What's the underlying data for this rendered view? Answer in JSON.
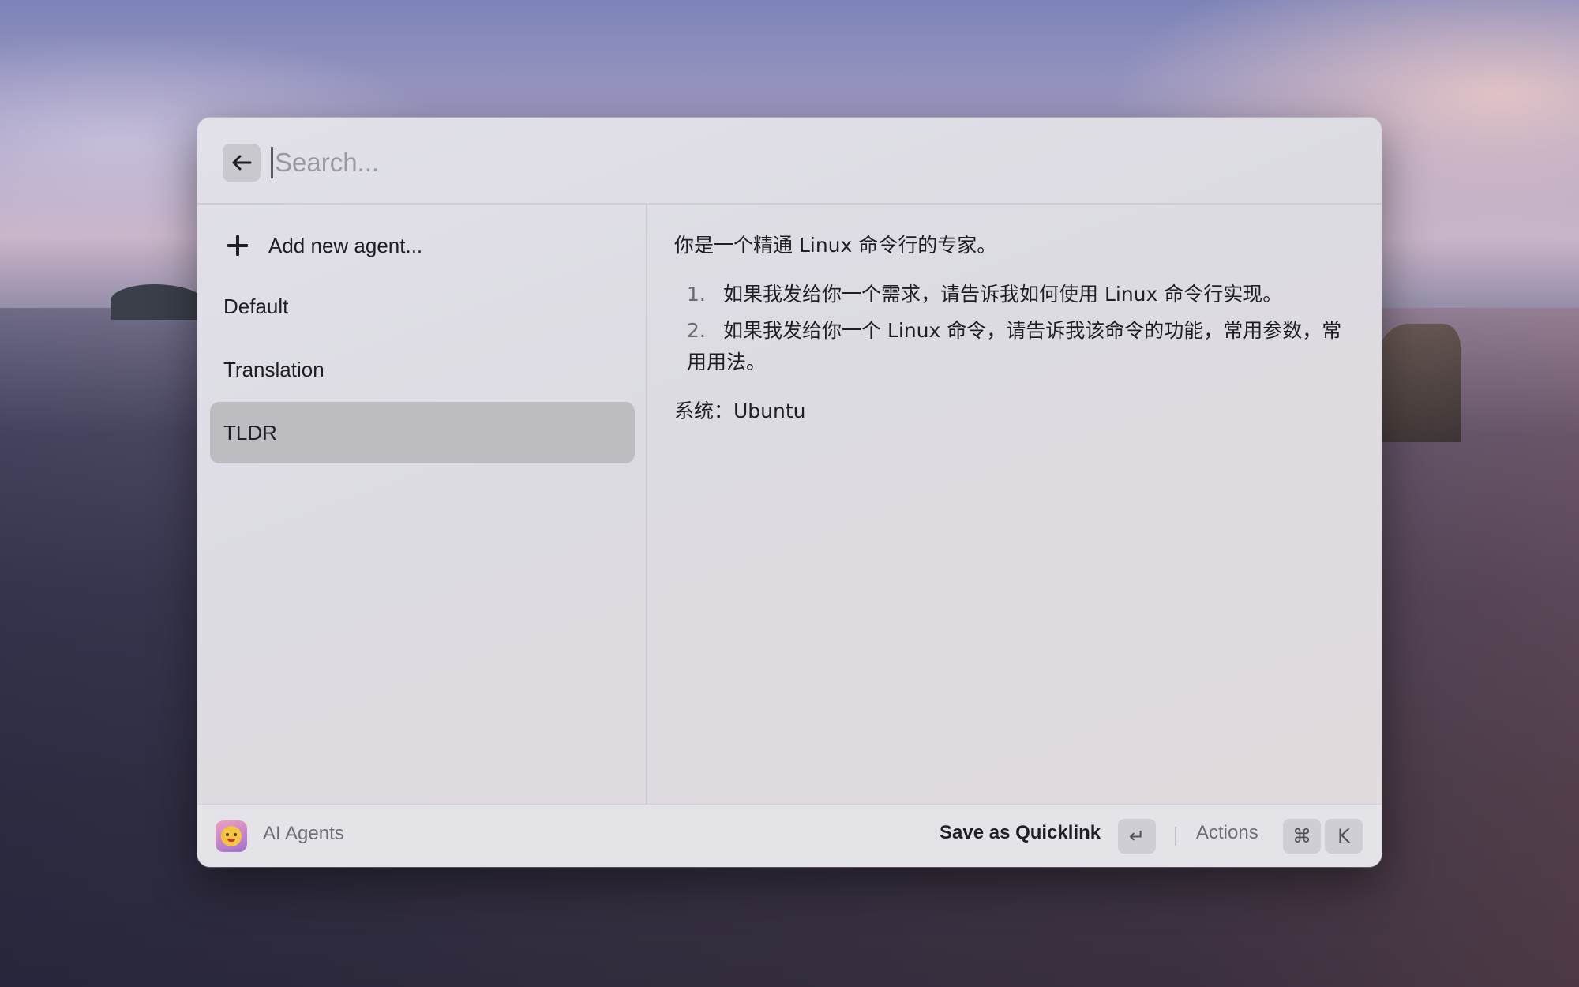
{
  "search": {
    "placeholder": "Search..."
  },
  "sidebar": {
    "add_label": "Add new agent...",
    "items": [
      {
        "label": "Default"
      },
      {
        "label": "Translation"
      },
      {
        "label": "TLDR"
      }
    ],
    "selected": "TLDR"
  },
  "detail": {
    "intro": "你是一个精通 Linux 命令行的专家。",
    "list": [
      {
        "num": "1.",
        "text": "如果我发给你一个需求，请告诉我如何使用 Linux 命令行实现。"
      },
      {
        "num": "2.",
        "text": "如果我发给你一个 Linux 命令，请告诉我该命令的功能，常用参数，常用用法。"
      }
    ],
    "system": "系统：Ubuntu"
  },
  "footer": {
    "app_name": "AI Agents",
    "primary_action": "Save as Quicklink",
    "enter_key": "↵",
    "actions_label": "Actions",
    "cmd_key": "⌘",
    "k_key": "K"
  },
  "icons": {
    "back": "arrow-left-icon",
    "add": "plus-icon",
    "app": "ai-agents-app-icon"
  }
}
